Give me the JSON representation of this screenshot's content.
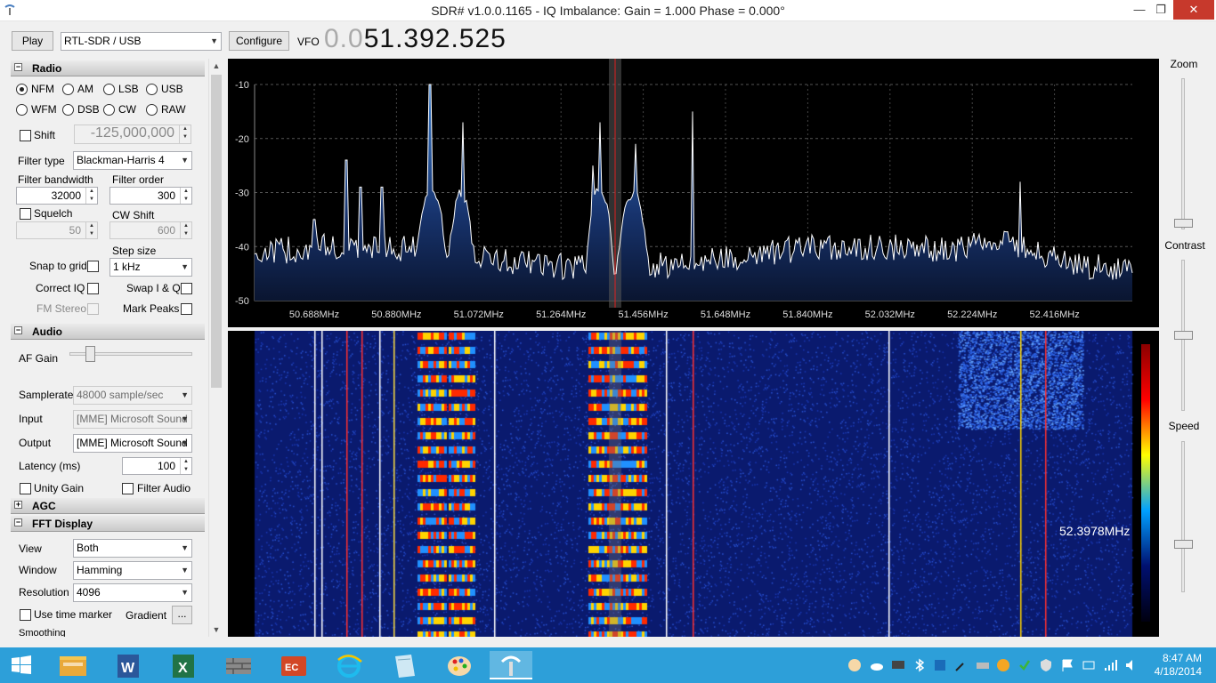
{
  "window": {
    "title": "SDR# v1.0.0.1165 - IQ Imbalance: Gain = 1.000 Phase = 0.000°",
    "minimize": "—",
    "maximize": "❐",
    "close": "✕"
  },
  "toolbar": {
    "play_label": "Play",
    "source_selected": "RTL-SDR / USB",
    "configure_label": "Configure",
    "vfo_label": "VFO",
    "vfo_dim": "0.0",
    "vfo_value": "51.392.525"
  },
  "radio": {
    "header": "Radio",
    "modes": [
      "NFM",
      "AM",
      "LSB",
      "USB",
      "WFM",
      "DSB",
      "CW",
      "RAW"
    ],
    "selected_mode": "NFM",
    "shift_label": "Shift",
    "shift_value": "-125,000,000",
    "filter_type_label": "Filter type",
    "filter_type_value": "Blackman-Harris 4",
    "filter_bandwidth_label": "Filter bandwidth",
    "filter_bandwidth_value": "32000",
    "filter_order_label": "Filter order",
    "filter_order_value": "300",
    "squelch_label": "Squelch",
    "squelch_value": "50",
    "cw_shift_label": "CW Shift",
    "cw_shift_value": "600",
    "step_size_label": "Step size",
    "step_size_value": "1 kHz",
    "snap_to_grid_label": "Snap to grid",
    "correct_iq_label": "Correct IQ",
    "swap_iq_label": "Swap I & Q",
    "fm_stereo_label": "FM Stereo",
    "mark_peaks_label": "Mark Peaks"
  },
  "audio": {
    "header": "Audio",
    "af_gain_label": "AF Gain",
    "af_gain_level": 0.13,
    "samplerate_label": "Samplerate",
    "samplerate_value": "48000 sample/sec",
    "input_label": "Input",
    "input_value": "[MME] Microsoft Sound",
    "output_label": "Output",
    "output_value": "[MME] Microsoft Sound",
    "latency_label": "Latency (ms)",
    "latency_value": "100",
    "unity_gain_label": "Unity Gain",
    "filter_audio_label": "Filter Audio"
  },
  "agc": {
    "header": "AGC"
  },
  "fft": {
    "header": "FFT Display",
    "view_label": "View",
    "view_value": "Both",
    "window_label": "Window",
    "window_value": "Hamming",
    "resolution_label": "Resolution",
    "resolution_value": "4096",
    "time_marker_label": "Use time marker",
    "gradient_label": "Gradient",
    "gradient_button": "...",
    "smoothing_label": "Smoothing"
  },
  "spectrum": {
    "y_ticks": [
      "-10",
      "-20",
      "-30",
      "-40",
      "-50"
    ],
    "x_ticks": [
      "50.688MHz",
      "50.880MHz",
      "51.072MHz",
      "51.264MHz",
      "51.456MHz",
      "51.648MHz",
      "51.840MHz",
      "52.032MHz",
      "52.224MHz",
      "52.416MHz"
    ],
    "cursor_readout": "52.3978MHz"
  },
  "right_controls": {
    "zoom_label": "Zoom",
    "contrast_label": "Contrast",
    "speed_label": "Speed"
  },
  "taskbar": {
    "apps": [
      "start-icon",
      "file-explorer-icon",
      "word-icon",
      "excel-icon",
      "firewall-icon",
      "media-icon",
      "internet-explorer-icon",
      "notes-icon",
      "paint-icon",
      "sdrsharp-icon"
    ],
    "time": "8:47 AM",
    "date": "4/18/2014"
  },
  "colors": {
    "spectrum_bg": "#000000",
    "trace": "#ffffff",
    "fill": "#1e4fa0",
    "taskbar": "#2d9fd9",
    "close_button": "#c7392c"
  }
}
